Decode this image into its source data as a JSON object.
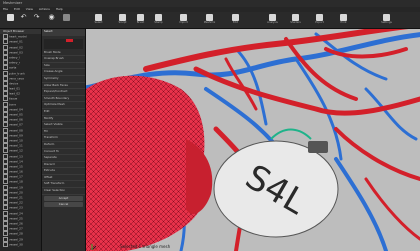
{
  "app": {
    "title": "Meshmixer"
  },
  "menu": [
    "File",
    "Edit",
    "View",
    "Actions",
    "Help"
  ],
  "toolbar": [
    {
      "icon": "select-icon",
      "label": "Select"
    },
    {
      "icon": "sculpt-icon",
      "label": "Sculpt"
    },
    {
      "icon": "brush-icon",
      "label": "Brush"
    },
    {
      "icon": "magnet-icon",
      "label": "Stamp"
    },
    {
      "icon": "folder-icon",
      "label": "Import"
    },
    {
      "icon": "shape-icon",
      "label": "Meshmix"
    },
    {
      "icon": "edit-icon",
      "label": "Edit"
    },
    {
      "icon": "hub-icon",
      "label": "Analysis"
    },
    {
      "icon": "shaders-icon",
      "label": "Shaders"
    },
    {
      "icon": "export-icon",
      "label": "Export"
    },
    {
      "icon": "print-icon",
      "label": "Print"
    },
    {
      "icon": "settings-icon",
      "label": "Settings"
    }
  ],
  "object_browser": {
    "title": "Object Browser",
    "items": [
      "heart_model",
      "vessel_01",
      "vessel_02",
      "vessel_03",
      "artery_l",
      "artery_r",
      "aorta",
      "pulm_trunk",
      "vena_cava",
      "device",
      "lead_01",
      "lead_02",
      "tissue",
      "bone",
      "vessel_04",
      "vessel_05",
      "vessel_06",
      "vessel_07",
      "vessel_08",
      "vessel_09",
      "vessel_10",
      "vessel_11",
      "vessel_12",
      "vessel_13",
      "vessel_14",
      "vessel_15",
      "vessel_16",
      "vessel_17",
      "vessel_18",
      "vessel_19",
      "vessel_20",
      "vessel_21",
      "vessel_22",
      "vessel_23",
      "vessel_24",
      "vessel_25",
      "vessel_26",
      "vessel_27",
      "vessel_28",
      "vessel_29",
      "vessel_30"
    ]
  },
  "properties": {
    "title": "Select",
    "rows": [
      "Brush Mode",
      "Unwrap Brush",
      "Size",
      "Crease Angle",
      "Symmetry",
      "Allow Back Faces",
      "Expand/Contract",
      "Smooth Boundary",
      "Optimize Mesh",
      "Edit",
      "Modify",
      "Select Visible",
      "Fill",
      "Transform",
      "Deform",
      "Convert To",
      "Separate",
      "Discard",
      "Extrude",
      "Offset",
      "Soft Transform",
      "Clear Selection"
    ],
    "buttons": [
      "Accept",
      "Cancel"
    ]
  },
  "status": {
    "message": "Selected 1 triangle mesh"
  },
  "device": {
    "label": "S4L"
  },
  "colors": {
    "artery": "#d3202a",
    "vein": "#2d6fd3",
    "heart": "#e8324a",
    "background": "#bfbfbf"
  }
}
